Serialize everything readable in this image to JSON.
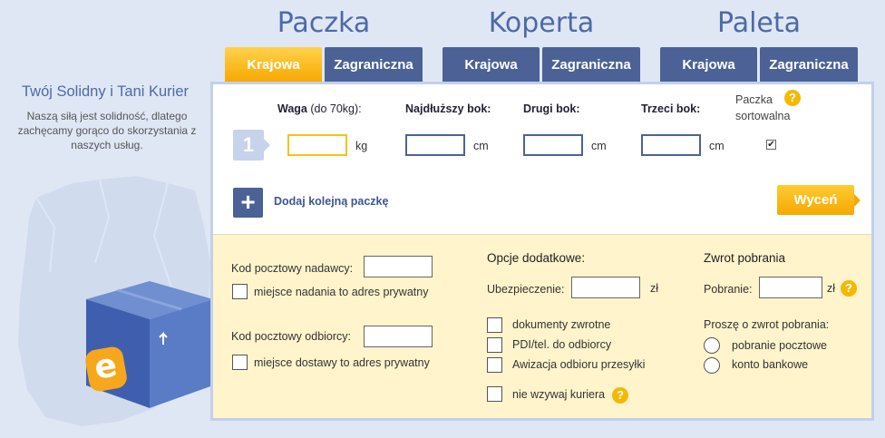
{
  "categories": {
    "paczka": "Paczka",
    "koperta": "Koperta",
    "paleta": "Paleta"
  },
  "tabs": {
    "krajowa": "Krajowa",
    "zagraniczna": "Zagraniczna"
  },
  "left": {
    "title": "Twój Solidny i Tani Kurier",
    "desc": "Naszą siłą jest solidność, dlatego zachęcamy gorąco do skorzystania z naszych usług."
  },
  "package": {
    "number": "1",
    "waga_label": "Waga",
    "waga_note": "(do 70kg):",
    "bok1_label": "Najdłuższy bok:",
    "bok2_label": "Drugi bok:",
    "bok3_label": "Trzeci bok:",
    "sort_label_1": "Paczka",
    "sort_label_2": "sortowalna",
    "unit_kg": "kg",
    "unit_cm": "cm",
    "sortowalna_checked": true
  },
  "add_package": "Dodaj kolejną paczkę",
  "wycen": "Wyceń",
  "addresses": {
    "sender_label": "Kod pocztowy nadawcy:",
    "sender_private": "miejsce nadania to adres prywatny",
    "receiver_label": "Kod pocztowy odbiorcy:",
    "receiver_private": "miejsce dostawy to adres prywatny"
  },
  "options": {
    "title": "Opcje dodatkowe:",
    "insurance_label": "Ubezpieczenie:",
    "currency": "zł",
    "items": [
      "dokumenty zwrotne",
      "PDI/tel. do odbiorcy",
      "Awizacja odbioru przesyłki"
    ],
    "no_courier": "nie wzywaj kuriera"
  },
  "cod": {
    "title": "Zwrot pobrania",
    "label": "Pobranie:",
    "currency": "zł",
    "return_label": "Proszę o zwrot pobrania:",
    "radios": [
      "pobranie pocztowe",
      "konto bankowe"
    ]
  },
  "colors": {
    "tab_blue": "#4c6296",
    "tab_active": "#f6a800",
    "title_blue": "#4d6aa7",
    "panel_yellow": "#fff4cc"
  }
}
